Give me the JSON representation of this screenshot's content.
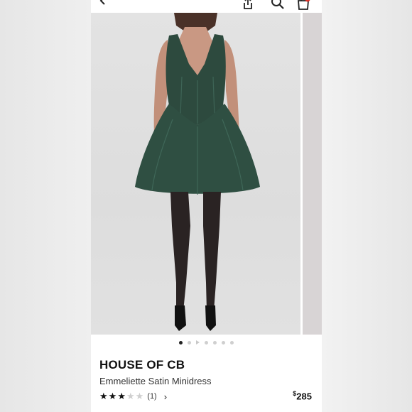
{
  "header": {
    "back_icon": "chevron-left-icon",
    "share_icon": "share-icon",
    "search_icon": "search-icon",
    "bag_icon": "shopping-bag-icon",
    "bag_badge_color": "#e0322a"
  },
  "gallery": {
    "image_count": 7,
    "active_index": 0,
    "video_index": 2,
    "dress_color": "#2d4a3e"
  },
  "product": {
    "brand": "HOUSE OF CB",
    "name": "Emmeliette Satin Minidress",
    "rating": 3,
    "rating_max": 5,
    "review_count": "(1)",
    "price_symbol": "$",
    "price_value": "285"
  }
}
